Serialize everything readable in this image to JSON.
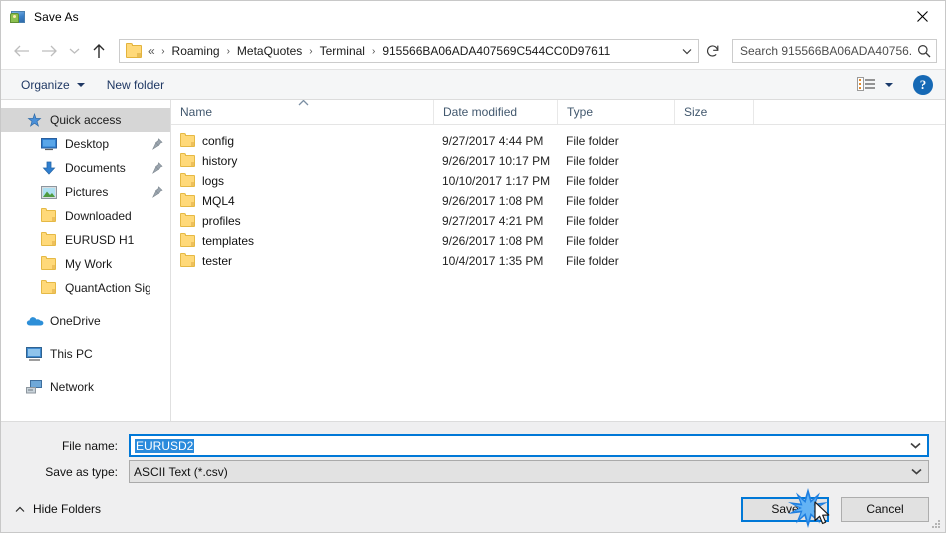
{
  "window": {
    "title": "Save As",
    "icon": "save-as-app-icon",
    "close_label": "✕"
  },
  "nav": {
    "back": "back-arrow",
    "forward": "forward-arrow",
    "recent": "recent-locations-chevron",
    "up": "up-arrow",
    "refresh": "refresh-icon"
  },
  "address": {
    "overflow": "«",
    "crumbs": [
      "Roaming",
      "MetaQuotes",
      "Terminal",
      "915566BA06ADA407569C544CC0D97611"
    ],
    "separator": "›",
    "dropdown": "chevron-down-icon"
  },
  "search": {
    "placeholder": "Search 915566BA06ADA40756...",
    "icon": "search-icon"
  },
  "toolbar": {
    "organize": "Organize",
    "new_folder": "New folder",
    "view_icon": "change-view-icon",
    "view_caret": "chevron-down-icon",
    "help": "?"
  },
  "sidebar": {
    "items": [
      {
        "label": "Quick access",
        "icon": "quick-access-star-icon",
        "level": 0,
        "selected": true,
        "pinned": false,
        "group_top": false
      },
      {
        "label": "Desktop",
        "icon": "desktop-icon",
        "level": 1,
        "selected": false,
        "pinned": true,
        "group_top": false
      },
      {
        "label": "Documents",
        "icon": "documents-download-icon",
        "level": 1,
        "selected": false,
        "pinned": true,
        "group_top": false
      },
      {
        "label": "Pictures",
        "icon": "pictures-icon",
        "level": 1,
        "selected": false,
        "pinned": true,
        "group_top": false
      },
      {
        "label": "Downloaded",
        "icon": "folder-icon",
        "level": 1,
        "selected": false,
        "pinned": false,
        "group_top": false
      },
      {
        "label": "EURUSD H1",
        "icon": "folder-icon",
        "level": 1,
        "selected": false,
        "pinned": false,
        "group_top": false
      },
      {
        "label": "My Work",
        "icon": "folder-icon",
        "level": 1,
        "selected": false,
        "pinned": false,
        "group_top": false
      },
      {
        "label": "QuantAction Signal",
        "icon": "folder-icon",
        "level": 1,
        "selected": false,
        "pinned": false,
        "group_top": false
      },
      {
        "label": "OneDrive",
        "icon": "onedrive-cloud-icon",
        "level": 0,
        "selected": false,
        "pinned": false,
        "group_top": true
      },
      {
        "label": "This PC",
        "icon": "this-pc-icon",
        "level": 0,
        "selected": false,
        "pinned": false,
        "group_top": true
      },
      {
        "label": "Network",
        "icon": "network-icon",
        "level": 0,
        "selected": false,
        "pinned": false,
        "group_top": true
      }
    ]
  },
  "filelist": {
    "columns": [
      "Name",
      "Date modified",
      "Type",
      "Size"
    ],
    "sort_column": "Name",
    "sort_direction": "ascending",
    "rows": [
      {
        "name": "config",
        "date": "9/27/2017 4:44 PM",
        "type": "File folder",
        "size": ""
      },
      {
        "name": "history",
        "date": "9/26/2017 10:17 PM",
        "type": "File folder",
        "size": ""
      },
      {
        "name": "logs",
        "date": "10/10/2017 1:17 PM",
        "type": "File folder",
        "size": ""
      },
      {
        "name": "MQL4",
        "date": "9/26/2017 1:08 PM",
        "type": "File folder",
        "size": ""
      },
      {
        "name": "profiles",
        "date": "9/27/2017 4:21 PM",
        "type": "File folder",
        "size": ""
      },
      {
        "name": "templates",
        "date": "9/26/2017 1:08 PM",
        "type": "File folder",
        "size": ""
      },
      {
        "name": "tester",
        "date": "10/4/2017 1:35 PM",
        "type": "File folder",
        "size": ""
      }
    ]
  },
  "form": {
    "filename_label": "File name:",
    "filename_value": "EURUSD2",
    "filetype_label": "Save as type:",
    "filetype_value": "ASCII Text (*.csv)"
  },
  "footer": {
    "hide_folders": "Hide Folders",
    "save": "Save",
    "cancel": "Cancel"
  },
  "colors": {
    "accent": "#0078d7",
    "folder": "#ffd979",
    "header_text": "#42586e",
    "selection": "#2a8bdc",
    "command_link": "#1f3864"
  }
}
